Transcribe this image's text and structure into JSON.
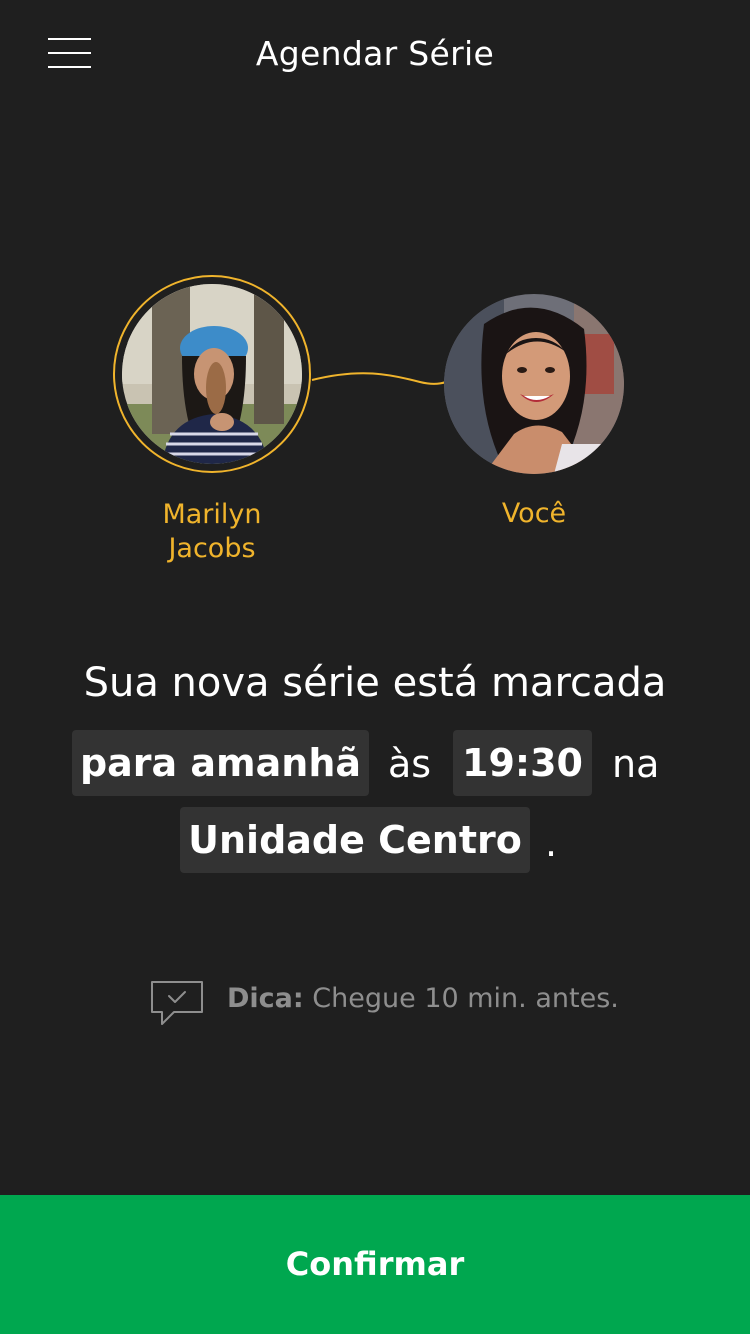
{
  "header": {
    "title": "Agendar Série",
    "menu_icon": "hamburger-menu-icon"
  },
  "participants": [
    {
      "name": "Marilyn Jacobs",
      "highlighted": true
    },
    {
      "name": "Você",
      "highlighted": false
    }
  ],
  "colors": {
    "background": "#1f1f1f",
    "accent": "#f0b42c",
    "chip": "#333333",
    "confirm": "#00a74f",
    "tip_text": "#8e8e8e"
  },
  "booking": {
    "intro": "Sua nova série está marcada",
    "date": "para amanhã",
    "at_word": "às",
    "time": "19:30",
    "in_word": "na",
    "location": "Unidade Centro",
    "end_punct": "."
  },
  "tip": {
    "icon": "chat-check-icon",
    "label": "Dica:",
    "text": "Chegue 10 min. antes."
  },
  "actions": {
    "confirm_label": "Confirmar"
  }
}
